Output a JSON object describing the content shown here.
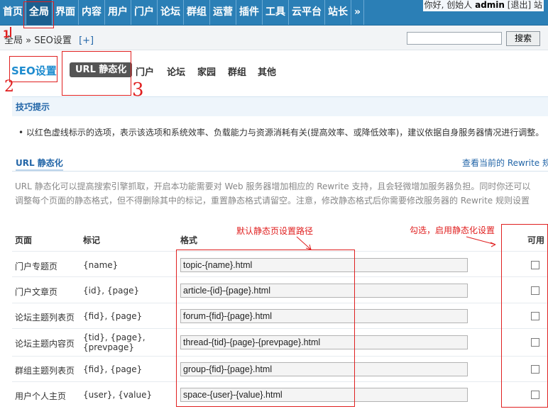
{
  "nav": {
    "items": [
      "首页",
      "全局",
      "界面",
      "内容",
      "用户",
      "门户",
      "论坛",
      "群组",
      "运营",
      "插件",
      "工具",
      "云平台",
      "站长",
      "»"
    ],
    "active_index": 1
  },
  "user": {
    "greeting": "你好, 创始人",
    "name": "admin",
    "logout": "[退出]",
    "extra": "站"
  },
  "breadcrumb": {
    "text": "全局 » SEO设置",
    "add": "[+]"
  },
  "search": {
    "value": "",
    "button": "搜索"
  },
  "page": {
    "title": "SEO设置"
  },
  "tabs": [
    "URL 静态化",
    "门户",
    "论坛",
    "家园",
    "群组",
    "其他"
  ],
  "tips": {
    "heading": "技巧提示",
    "text": "以红色虚线标示的选项，表示该选项和系统效率、负载能力与资源消耗有关(提高效率、或降低效率)，建议依据自身服务器情况进行调整。"
  },
  "section": {
    "heading": "URL 静态化",
    "view_current": "查看当前的 Rewrite 规则",
    "description": "URL 静态化可以提高搜索引擎抓取，开启本功能需要对 Web 服务器增加相应的 Rewrite 支持，且会轻微增加服务器负担。同时你还可以调整每个页面的静态格式，但不得删除其中的标记，重置静态格式请留空。注意，修改静态格式后你需要修改服务器的 Rewrite 规则设置"
  },
  "table": {
    "headers": [
      "页面",
      "标记",
      "格式",
      "可用"
    ],
    "rows": [
      {
        "page": "门户专题页",
        "marks": "{name}",
        "format": "topic-{name}.html"
      },
      {
        "page": "门户文章页",
        "marks": "{id}, {page}",
        "format": "article-{id}-{page}.html"
      },
      {
        "page": "论坛主题列表页",
        "marks": "{fid}, {page}",
        "format": "forum-{fid}-{page}.html"
      },
      {
        "page": "论坛主题内容页",
        "marks": "{tid}, {page}, {prevpage}",
        "format": "thread-{tid}-{page}-{prevpage}.html"
      },
      {
        "page": "群组主题列表页",
        "marks": "{fid}, {page}",
        "format": "group-{fid}-{page}.html"
      },
      {
        "page": "用户个人主页",
        "marks": "{user}, {value}",
        "format": "space-{user}-{value}.html"
      }
    ]
  },
  "annotations": {
    "n1": "1",
    "n2": "2",
    "n3": "3",
    "default_path": "默认静态页设置路径",
    "check_enable": "勾选，启用静态化设置",
    "color": "#e02020"
  },
  "colors": {
    "nav_bg": "#2b7fb6",
    "nav_active": "#1b5f8f",
    "link": "#2366a8",
    "title": "#1f8ccf"
  }
}
